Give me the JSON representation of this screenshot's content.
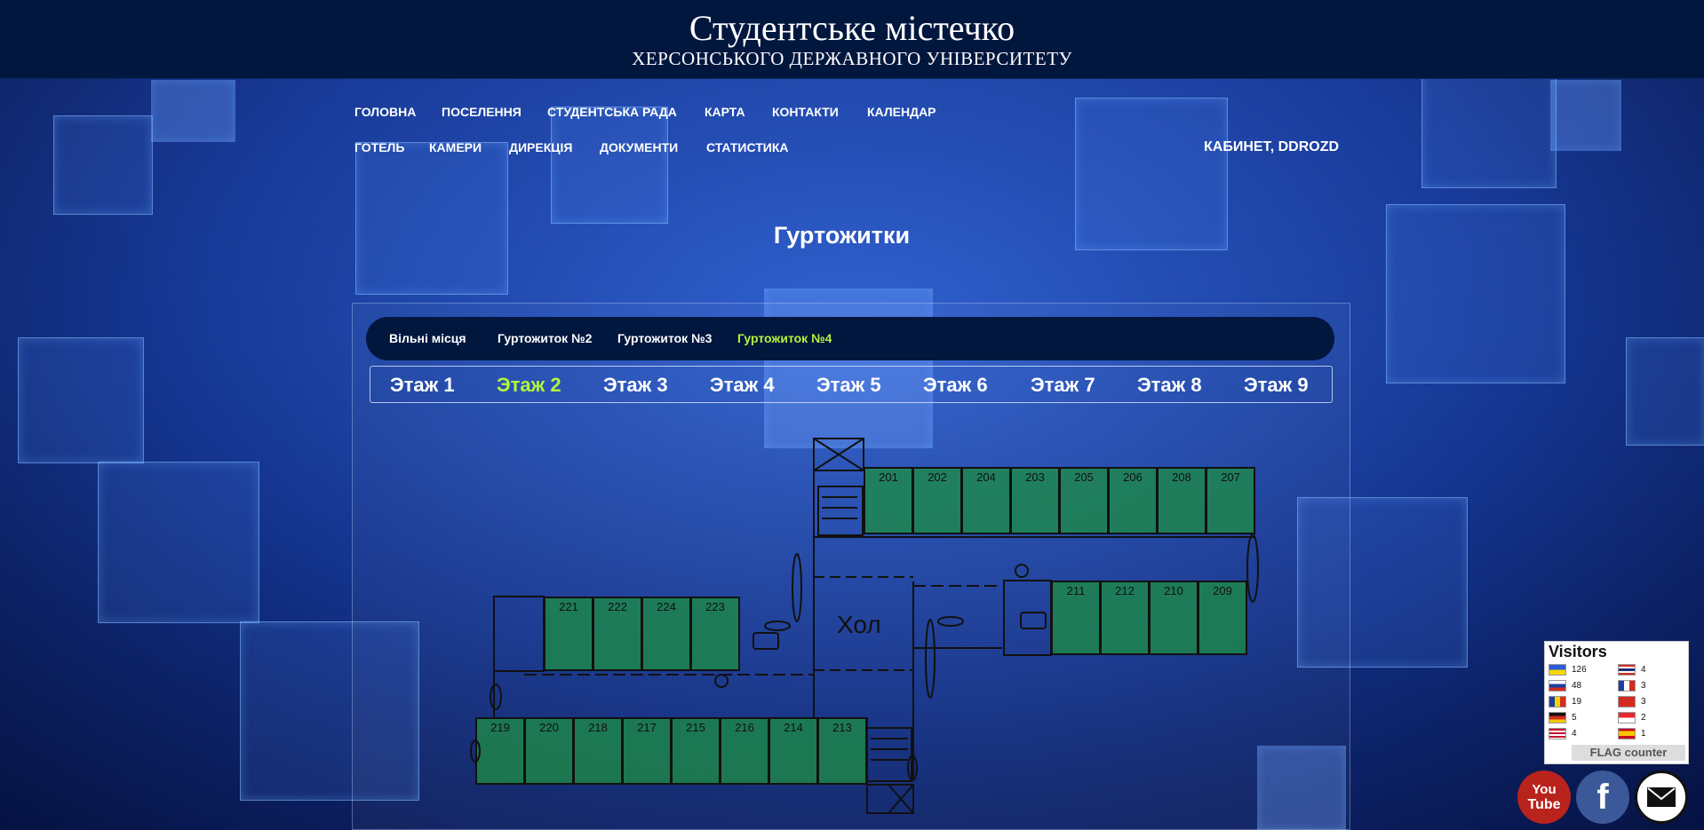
{
  "header": {
    "title": "Студентське містечко",
    "subtitle": "ХЕРСОНСЬКОГО ДЕРЖАВНОГО УНІВЕРСИТЕТУ"
  },
  "nav": {
    "row1": [
      "ГОЛОВНА",
      "ПОСЕЛЕННЯ",
      "СТУДЕНТСЬКА РАДА",
      "КАРТА",
      "КОНТАКТИ",
      "КАЛЕНДАР"
    ],
    "row2": [
      "ГОТЕЛЬ",
      "КАМЕРИ",
      "ДИРЕКЦІЯ",
      "ДОКУМЕНТИ",
      "СТАТИСТИКА"
    ],
    "account": "КАБИНЕТ, DDROZD"
  },
  "page_title": "Гуртожитки",
  "tabs": {
    "items": [
      "Вільні місця",
      "Гуртожиток №2",
      "Гуртожиток №3",
      "Гуртожиток №4"
    ],
    "active": "Гуртожиток №4"
  },
  "floors": {
    "items": [
      "Этаж 1",
      "Этаж 2",
      "Этаж 3",
      "Этаж 4",
      "Этаж 5",
      "Этаж 6",
      "Этаж 7",
      "Этаж 8",
      "Этаж 9"
    ],
    "active": "Этаж 2"
  },
  "floor_plan": {
    "hall_label": "Хол",
    "rooms_top": [
      "201",
      "202",
      "204",
      "203",
      "205",
      "206",
      "208",
      "207"
    ],
    "rooms_right": [
      "211",
      "212",
      "210",
      "209"
    ],
    "rooms_mid": [
      "221",
      "222",
      "224",
      "223"
    ],
    "rooms_bottom": [
      "219",
      "220",
      "218",
      "217",
      "215",
      "216",
      "214",
      "213"
    ],
    "room_status_color": "#1e8c46"
  },
  "visitors_widget": {
    "title": "Visitors",
    "counts": [
      {
        "country": "UA",
        "count": "126"
      },
      {
        "country": "RU",
        "count": "48"
      },
      {
        "country": "RO",
        "count": "19"
      },
      {
        "country": "DE",
        "count": "5"
      },
      {
        "country": "US",
        "count": "4"
      },
      {
        "country": "TH",
        "count": "4"
      },
      {
        "country": "FR",
        "count": "3"
      },
      {
        "country": "TR",
        "count": "3"
      },
      {
        "country": "SG",
        "count": "2"
      },
      {
        "country": "ES",
        "count": "1"
      }
    ],
    "footer": "FLAG counter"
  },
  "social": {
    "youtube_line1": "You",
    "youtube_line2": "Tube",
    "facebook": "f"
  },
  "colors": {
    "header_bg": "#02173e",
    "active_tab": "#b4f53c",
    "text": "#ffffff"
  }
}
